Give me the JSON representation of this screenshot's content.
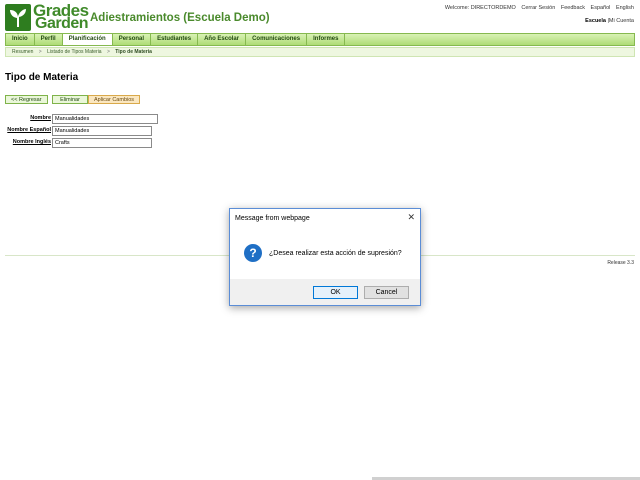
{
  "brand": {
    "name_line1": "Grades",
    "name_line2": "Garden",
    "logo_icon": "sprout-icon"
  },
  "app_title": "Adiestramientos (Escuela Demo)",
  "top_links": {
    "welcome": "Welcome: DIRECTORDEMO",
    "logout": "Cerrar Sesión",
    "feedback": "Feedback",
    "spanish": "Español",
    "english": "English"
  },
  "school_links": {
    "school": "Escuela",
    "separator": "|",
    "account": "Mi Cuenta"
  },
  "nav": {
    "items": [
      "Inicio",
      "Perfil",
      "Planificación",
      "Personal",
      "Estudiantes",
      "Año Escolar",
      "Comunicaciones",
      "Informes"
    ],
    "active_index": 2
  },
  "breadcrumb": {
    "items": [
      "Resumen",
      "Listado de Tipos Materia",
      "Tipo de Materia"
    ],
    "separator": ">"
  },
  "page_title": "Tipo de Materia",
  "actions": {
    "back": "<< Regresar",
    "delete": "Eliminar",
    "apply": "Aplicar Cambios"
  },
  "form": {
    "name_label": "Nombre",
    "name_value": "Manualidades",
    "spanish_label": "Nombre Español",
    "spanish_value": "Manualidades",
    "english_label": "Nombre Inglés",
    "english_value": "Crafts"
  },
  "release": "Release 3.3",
  "dialog": {
    "title": "Message from webpage",
    "close": "✕",
    "icon_glyph": "?",
    "message": "¿Desea realizar esta acción de supresión?",
    "ok": "OK",
    "cancel": "Cancel"
  },
  "colors": {
    "brand_green": "#3f8a2a",
    "nav_green": "#aedc76",
    "dialog_accent": "#0078d7",
    "question_icon": "#1f6fc5"
  }
}
